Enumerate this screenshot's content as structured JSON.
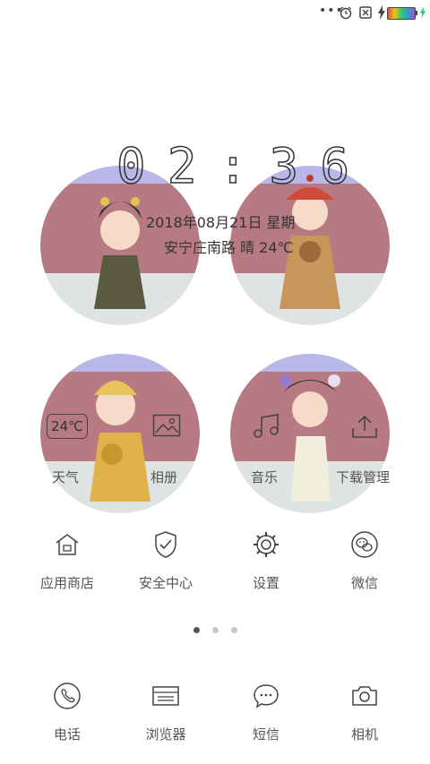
{
  "status_bar": {
    "more": "•••"
  },
  "clock": {
    "h1": "0",
    "h2": "2",
    "sep": ":",
    "m1": "3",
    "m2": "6"
  },
  "date_line": "2018年08月21日 星期",
  "location_weather": "安宁庄南路 晴 24℃",
  "widgets": [
    {
      "label": "天气",
      "badge": "24℃",
      "icon": "weather-badge-icon"
    },
    {
      "label": "相册",
      "icon": "image-icon"
    },
    {
      "label": "音乐",
      "icon": "music-note-icon"
    },
    {
      "label": "下载管理",
      "icon": "upload-icon"
    }
  ],
  "apps": [
    {
      "label": "应用商店",
      "icon": "store-icon"
    },
    {
      "label": "安全中心",
      "icon": "shield-check-icon"
    },
    {
      "label": "设置",
      "icon": "gear-icon"
    },
    {
      "label": "微信",
      "icon": "wechat-icon"
    }
  ],
  "pager": {
    "count": 3,
    "active": 0
  },
  "dock": [
    {
      "label": "电话",
      "icon": "phone-icon"
    },
    {
      "label": "浏览器",
      "icon": "browser-icon"
    },
    {
      "label": "短信",
      "icon": "message-icon"
    },
    {
      "label": "相机",
      "icon": "camera-icon"
    }
  ],
  "colors": {
    "sky": "#b9b6e8",
    "wall": "#b87a82",
    "ground": "#dfe3e3"
  }
}
